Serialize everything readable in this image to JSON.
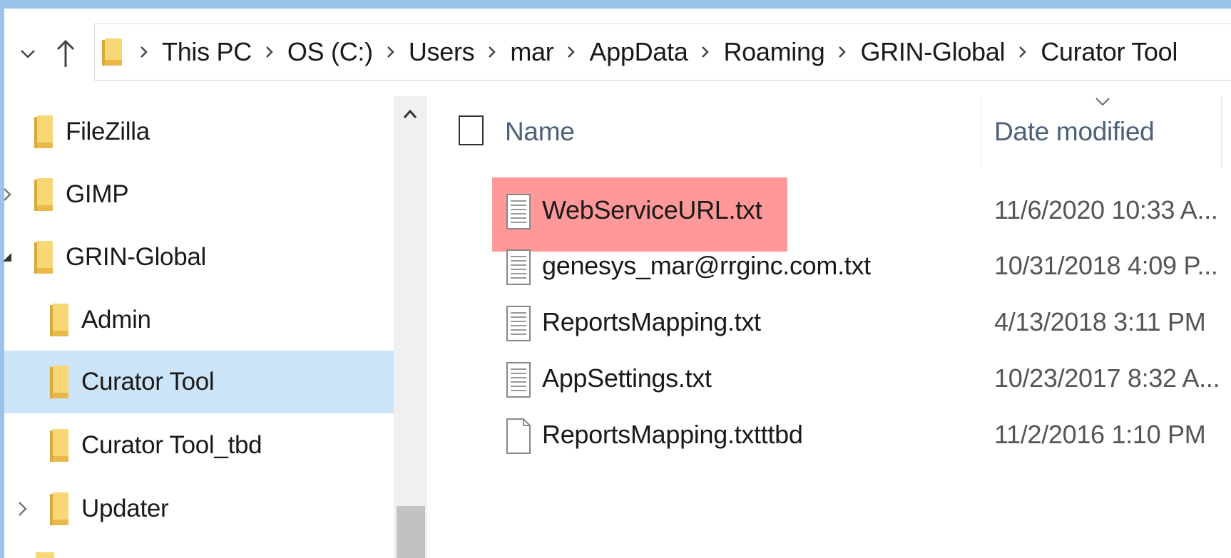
{
  "breadcrumb": [
    "This PC",
    "OS (C:)",
    "Users",
    "mar",
    "AppData",
    "Roaming",
    "GRIN-Global",
    "Curator Tool"
  ],
  "nav_tree": [
    {
      "label": "FileZilla",
      "level": 0,
      "expander": "none"
    },
    {
      "label": "GIMP",
      "level": 0,
      "expander": "collapsed"
    },
    {
      "label": "GRIN-Global",
      "level": 0,
      "expander": "expanded"
    },
    {
      "label": "Admin",
      "level": 1,
      "expander": "none"
    },
    {
      "label": "Curator Tool",
      "level": 1,
      "expander": "none",
      "selected": true
    },
    {
      "label": "Curator Tool_tbd",
      "level": 1,
      "expander": "none"
    },
    {
      "label": "Updater",
      "level": 1,
      "expander": "collapsed"
    }
  ],
  "columns": {
    "name": "Name",
    "date_modified": "Date modified"
  },
  "files": [
    {
      "name": "WebServiceURL.txt",
      "date": "11/6/2020 10:33 A...",
      "icon": "text-file-icon",
      "highlighted": true
    },
    {
      "name": "genesys_mar@rrginc.com.txt",
      "date": "10/31/2018 4:09 P...",
      "icon": "text-file-icon"
    },
    {
      "name": "ReportsMapping.txt",
      "date": "4/13/2018 3:11 PM",
      "icon": "text-file-icon"
    },
    {
      "name": "AppSettings.txt",
      "date": "10/23/2017 8:32 A...",
      "icon": "text-file-icon"
    },
    {
      "name": "ReportsMapping.txtttbd",
      "date": "11/2/2016 1:10 PM",
      "icon": "blank-file-icon"
    }
  ],
  "colors": {
    "selection": "#cce4f7",
    "highlight": "#ff9899",
    "folder": "#f8d775",
    "frame": "#9bc3ea"
  }
}
